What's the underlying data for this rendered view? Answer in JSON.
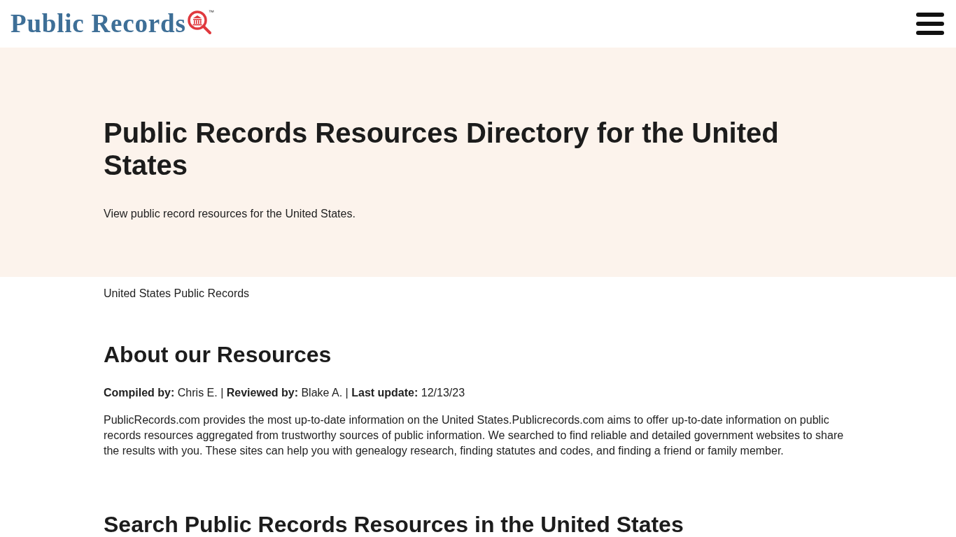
{
  "header": {
    "logo": {
      "text": "Public Records",
      "trademark": "™"
    }
  },
  "hero": {
    "title": "Public Records Resources Directory for the United States",
    "subtitle": "View public record resources for the United States."
  },
  "breadcrumb": "United States Public Records",
  "sections": [
    {
      "heading": "About our Resources",
      "meta": "**Compiled by:** Chris E. | **Reviewed by:** Blake A. | **Last update:** 12/13/23",
      "paragraph": "PublicRecords.com provides the most up-to-date information on the United States.Publicrecords.com aims to offer up-to-date information on public records resources aggregated from trustworthy sources of public information. We searched to find reliable and detailed government websites to share the results with you. These sites can help you with genealogy research, finding statutes and codes, and finding a friend or family member."
    },
    {
      "heading": "Search Public Records Resources in the United States"
    }
  ]
}
